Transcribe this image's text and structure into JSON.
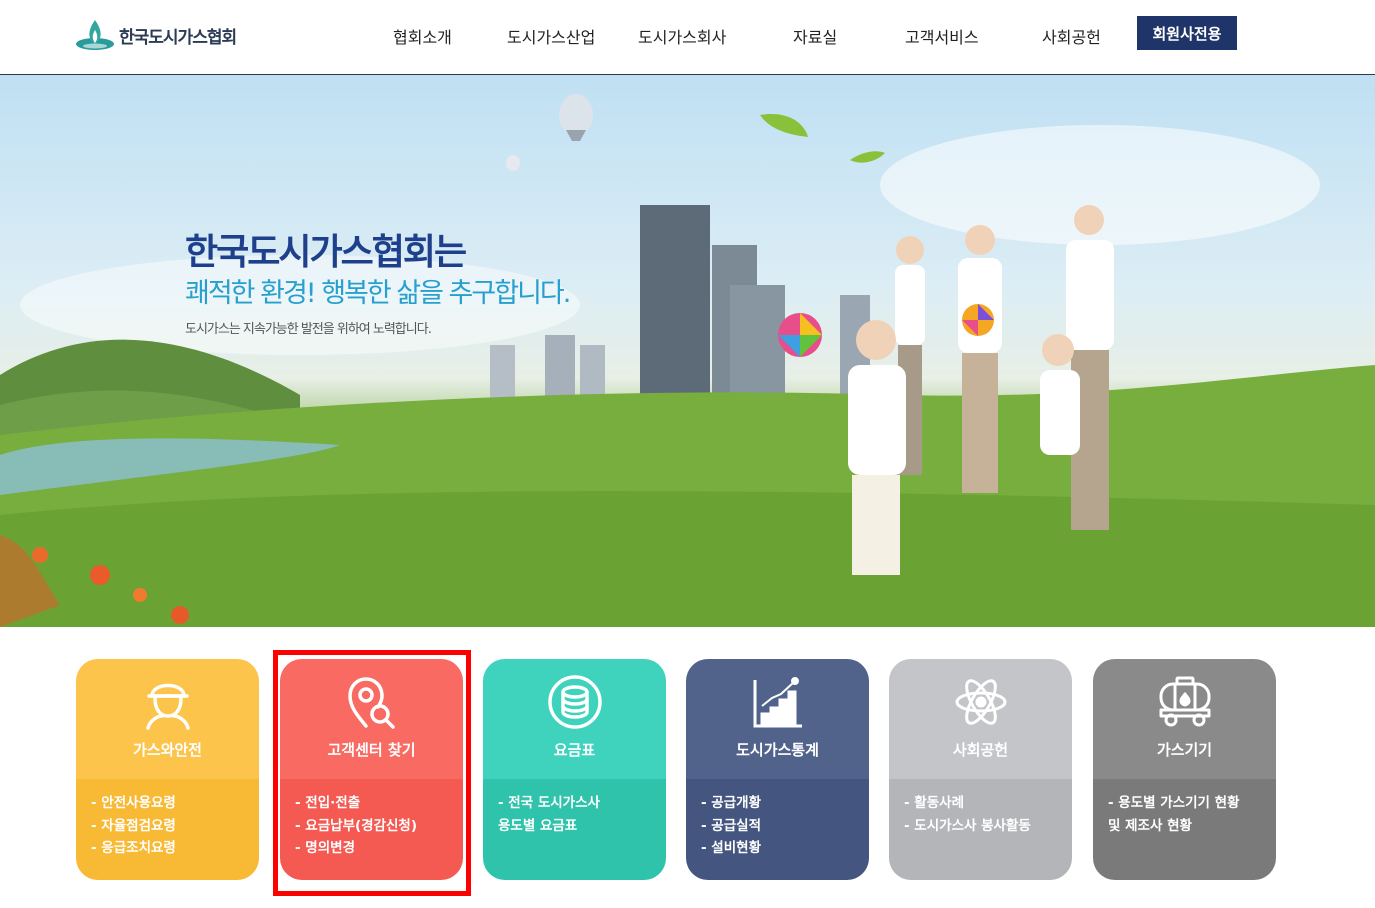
{
  "header": {
    "logo_text": "한국도시가스협회",
    "nav": [
      "협회소개",
      "도시가스산업",
      "도시가스회사",
      "자료실",
      "고객서비스",
      "사회공헌"
    ],
    "member_button": "회원사전용"
  },
  "hero": {
    "headline": "한국도시가스협회는",
    "subheadline": "쾌적한 환경! 행복한 삶을 추구합니다.",
    "caption": "도시가스는 지속가능한 발전을 위하여 노력합니다."
  },
  "cards": [
    {
      "title": "가스와안전",
      "icon": "worker-helmet-icon",
      "top_color": "#fdc44c",
      "bottom_color": "#f8b935",
      "links": [
        "- 안전사용요령",
        "- 자율점검요령",
        "- 응급조치요령"
      ]
    },
    {
      "title": "고객센터 찾기",
      "icon": "location-search-icon",
      "top_color": "#f86a62",
      "bottom_color": "#f45a52",
      "links": [
        "- 전입·전출",
        "- 요금납부(경감신청)",
        "- 명의변경"
      ]
    },
    {
      "title": "요금표",
      "icon": "coins-icon",
      "top_color": "#3fd2bc",
      "bottom_color": "#2fc3ac",
      "links": [
        "- 전국 도시가스사",
        "용도별 요금표"
      ]
    },
    {
      "title": "도시가스통계",
      "icon": "bar-chart-icon",
      "top_color": "#52638b",
      "bottom_color": "#44567f",
      "links": [
        "- 공급개황",
        "- 공급실적",
        "- 설비현황"
      ]
    },
    {
      "title": "사회공헌",
      "icon": "atom-icon",
      "top_color": "#c4c5c8",
      "bottom_color": "#b4b5b8",
      "links": [
        "- 활동사례",
        "- 도시가스사 봉사활동"
      ]
    },
    {
      "title": "가스기기",
      "icon": "tank-truck-icon",
      "top_color": "#8a8a8a",
      "bottom_color": "#7a7a7a",
      "links": [
        "- 용도별 가스기기 현황",
        "및 제조사 현황"
      ]
    }
  ]
}
